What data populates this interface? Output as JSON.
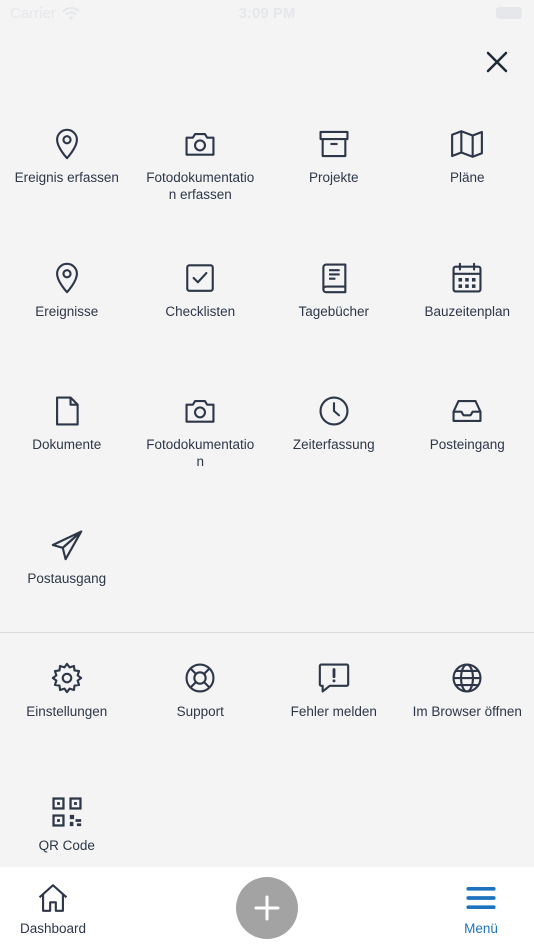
{
  "status_bar": {
    "carrier": "Carrier",
    "time": "3:09 PM"
  },
  "menu": {
    "items": [
      {
        "label": "Ereignis erfassen",
        "icon": "map-pin-icon"
      },
      {
        "label": "Fotodokumentation erfassen",
        "icon": "camera-icon"
      },
      {
        "label": "Projekte",
        "icon": "archive-box-icon"
      },
      {
        "label": "Pläne",
        "icon": "map-icon"
      },
      {
        "label": "Ereignisse",
        "icon": "map-pin-icon"
      },
      {
        "label": "Checklisten",
        "icon": "checkbox-icon"
      },
      {
        "label": "Tagebücher",
        "icon": "book-icon"
      },
      {
        "label": "Bauzeitenplan",
        "icon": "calendar-icon"
      },
      {
        "label": "Dokumente",
        "icon": "document-icon"
      },
      {
        "label": "Fotodokumentation",
        "icon": "camera-icon"
      },
      {
        "label": "Zeiterfassung",
        "icon": "clock-icon"
      },
      {
        "label": "Posteingang",
        "icon": "inbox-icon"
      },
      {
        "label": "Postausgang",
        "icon": "paper-plane-icon"
      }
    ],
    "secondary_items": [
      {
        "label": "Einstellungen",
        "icon": "gear-icon"
      },
      {
        "label": "Support",
        "icon": "lifebuoy-icon"
      },
      {
        "label": "Fehler melden",
        "icon": "alert-message-icon"
      },
      {
        "label": "Im Browser öffnen",
        "icon": "globe-icon"
      },
      {
        "label": "QR Code",
        "icon": "qr-code-icon"
      }
    ]
  },
  "tab_bar": {
    "dashboard_label": "Dashboard",
    "menu_label": "Menü",
    "active_color": "#1e73be"
  }
}
